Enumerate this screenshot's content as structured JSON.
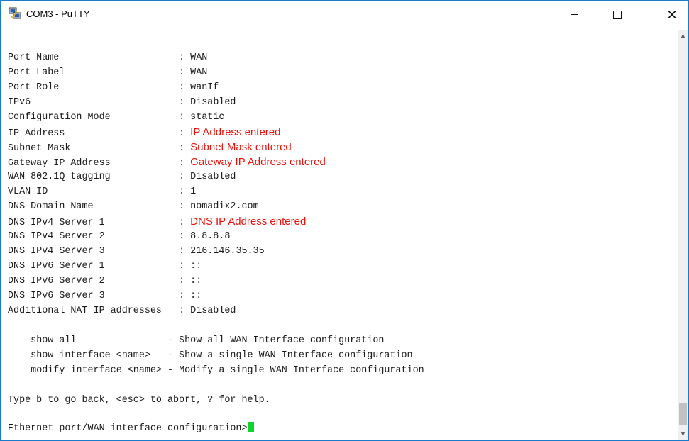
{
  "window": {
    "title": "COM3 - PuTTY",
    "controls": {
      "minimize": "minimize-icon",
      "maximize": "maximize-icon",
      "close": "close-icon"
    }
  },
  "terminal": {
    "fields": [
      {
        "label": "Port Name",
        "value": "WAN"
      },
      {
        "label": "Port Label",
        "value": "WAN"
      },
      {
        "label": "Port Role",
        "value": "wanIf"
      },
      {
        "label": "IPv6",
        "value": "Disabled"
      },
      {
        "label": "Configuration Mode",
        "value": "static"
      },
      {
        "label": "IP Address",
        "value": "IP Address entered",
        "annotation": true
      },
      {
        "label": "Subnet Mask",
        "value": "Subnet Mask entered",
        "annotation": true
      },
      {
        "label": "Gateway IP Address",
        "value": "Gateway IP Address entered",
        "annotation": true
      },
      {
        "label": "WAN 802.1Q tagging",
        "value": "Disabled"
      },
      {
        "label": "VLAN ID",
        "value": "1"
      },
      {
        "label": "DNS Domain Name",
        "value": "nomadix2.com"
      },
      {
        "label": "DNS IPv4 Server 1",
        "value": "DNS IP Address entered",
        "annotation": true
      },
      {
        "label": "DNS IPv4 Server 2",
        "value": "8.8.8.8"
      },
      {
        "label": "DNS IPv4 Server 3",
        "value": "216.146.35.35"
      },
      {
        "label": "DNS IPv6 Server 1",
        "value": "::"
      },
      {
        "label": "DNS IPv6 Server 2",
        "value": "::"
      },
      {
        "label": "DNS IPv6 Server 3",
        "value": "::"
      },
      {
        "label": "Additional NAT IP addresses",
        "value": "Disabled"
      }
    ],
    "separator": ": ",
    "commands": [
      {
        "command": "show all",
        "description": "- Show all WAN Interface configuration"
      },
      {
        "command": "show interface <name>",
        "description": "- Show a single WAN Interface configuration"
      },
      {
        "command": "modify interface <name>",
        "description": "- Modify a single WAN Interface configuration"
      }
    ],
    "help_text": "Type b to go back, <esc> to abort, ? for help.",
    "prompt": "Ethernet port/WAN interface configuration>"
  },
  "colors": {
    "annotation": "#e8120c",
    "cursor": "#0cd62c",
    "window_border": "#1979ca"
  }
}
